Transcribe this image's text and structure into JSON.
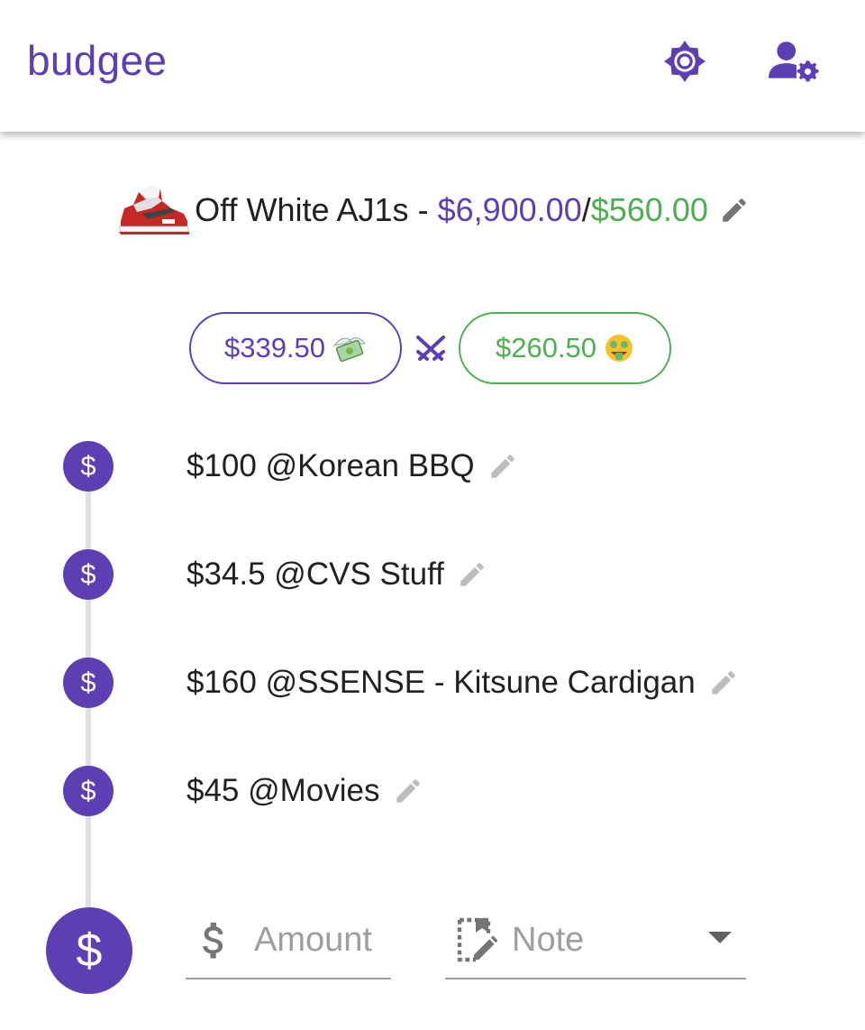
{
  "app_bar": {
    "brand": "budgee",
    "theme_toggle_icon": "brightness-icon",
    "account_settings_icon": "account-settings-icon"
  },
  "budget": {
    "icon": "sneaker-image",
    "name": "Off White AJ1s",
    "separator": " - ",
    "total": "$6,900.00",
    "slash": "/",
    "limit": "$560.00",
    "edit_icon": "pencil-icon"
  },
  "summary": {
    "spent": "$339.50",
    "spent_emoji": "money-with-wings",
    "versus_icon": "crossed-swords-icon",
    "remaining": "$260.50",
    "remaining_emoji": "money-mouth-face"
  },
  "expenses": [
    {
      "text": "$100 @Korean BBQ",
      "icon": "$"
    },
    {
      "text": "$34.5 @CVS Stuff",
      "icon": "$"
    },
    {
      "text": "$160 @SSENSE - Kitsune Cardigan",
      "icon": "$"
    },
    {
      "text": "$45 @Movies",
      "icon": "$"
    }
  ],
  "new_expense": {
    "icon": "$",
    "amount_placeholder": "Amount",
    "note_placeholder": "Note"
  },
  "colors": {
    "primary": "#5e3fb3",
    "success": "#4caf50",
    "muted": "#9e9e9e"
  }
}
